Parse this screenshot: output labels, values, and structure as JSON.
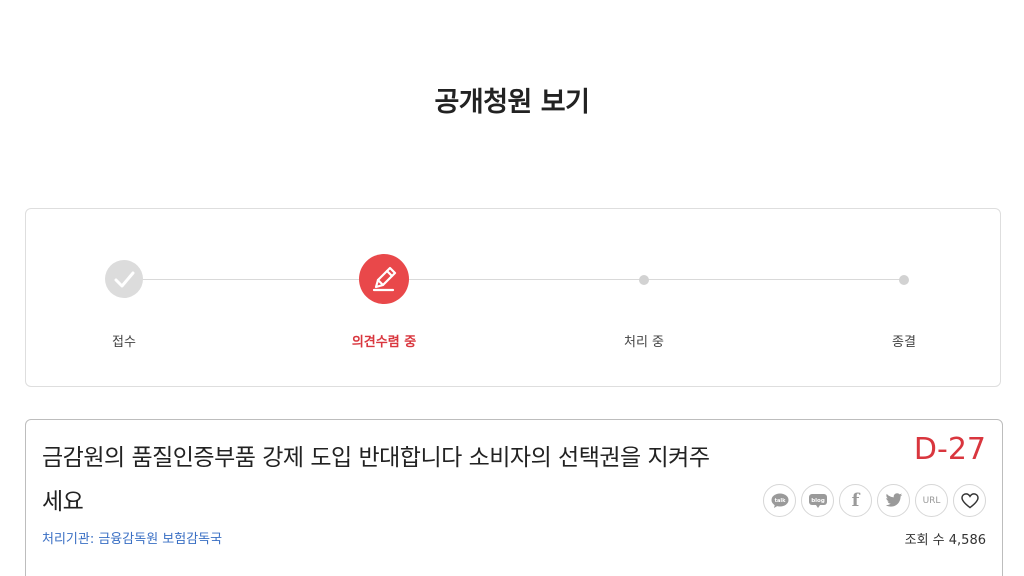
{
  "page": {
    "title": "공개청원 보기"
  },
  "progress": {
    "steps": [
      {
        "label": "접수",
        "state": "done",
        "icon": "check-icon"
      },
      {
        "label": "의견수렴 중",
        "state": "active",
        "icon": "pencil-icon"
      },
      {
        "label": "처리 중",
        "state": "pending",
        "icon": "dot"
      },
      {
        "label": "종결",
        "state": "pending",
        "icon": "dot"
      }
    ],
    "colors": {
      "active": "#e9484a",
      "done": "#dcdcdc",
      "pending": "#d2d2d2"
    }
  },
  "petition": {
    "title_line1": "금감원의 품질인증부품 강제 도입 반대합니다 소비자의 선택권을 지켜주",
    "title_line2": "세요",
    "dday": "D-27",
    "agency": "처리기관: 금융감독원 보험감독국",
    "views_label": "조회 수",
    "views_value": "4,586",
    "share": [
      {
        "icon": "kakaotalk-icon",
        "label": "talk"
      },
      {
        "icon": "blog-icon",
        "label": "blog"
      },
      {
        "icon": "facebook-icon",
        "label": "f"
      },
      {
        "icon": "twitter-icon",
        "label": ""
      },
      {
        "icon": "url-icon",
        "label": "URL"
      },
      {
        "icon": "heart-icon",
        "label": ""
      }
    ]
  }
}
